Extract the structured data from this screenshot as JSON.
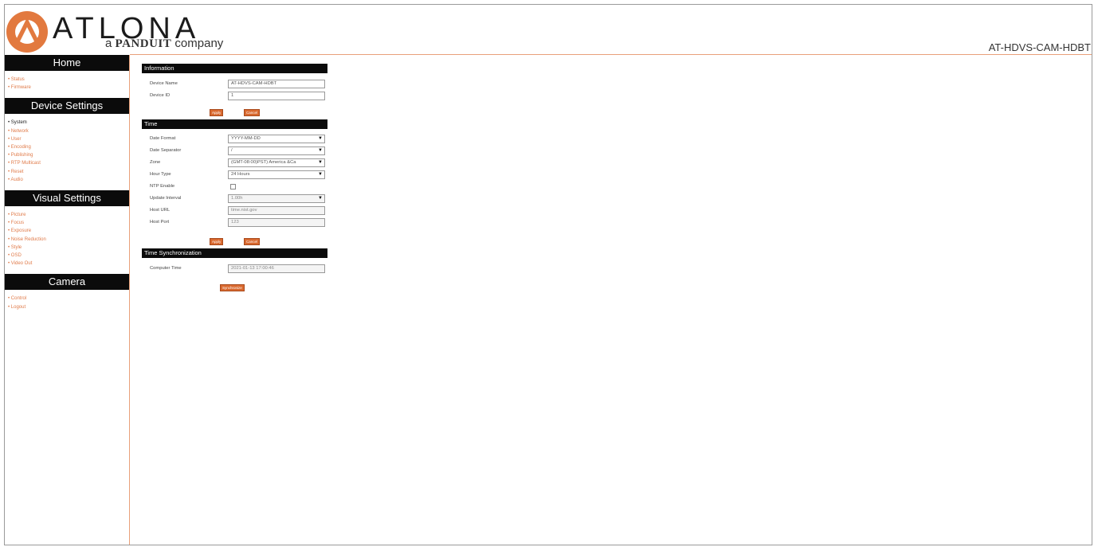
{
  "header": {
    "brand": "ATLONA",
    "tagline_prefix": "a",
    "tagline_brand": "PANDUIT",
    "tagline_suffix": "company",
    "model": "AT-HDVS-CAM-HDBT"
  },
  "sidebar": {
    "sections": [
      {
        "title": "Home",
        "items": [
          "Status",
          "Firmware"
        ]
      },
      {
        "title": "Device Settings",
        "items": [
          "System",
          "Network",
          "User",
          "Encoding",
          "Publishing",
          "RTP Multicast",
          "Reset",
          "Audio"
        ]
      },
      {
        "title": "Visual Settings",
        "items": [
          "Picture",
          "Focus",
          "Exposure",
          "Noise Reduction",
          "Style",
          "OSD",
          "Video Out"
        ]
      },
      {
        "title": "Camera",
        "items": [
          "Control",
          "Logout"
        ]
      }
    ]
  },
  "information": {
    "title": "Information",
    "device_name_label": "Device Name",
    "device_name_value": "AT-HDVS-CAM-HDBT",
    "device_id_label": "Device ID",
    "device_id_value": "1",
    "apply_label": "Apply",
    "cancel_label": "Cancel"
  },
  "time": {
    "title": "Time",
    "date_format_label": "Date Format",
    "date_format_value": "YYYY-MM-DD",
    "date_separator_label": "Date Separator",
    "date_separator_value": "/",
    "zone_label": "Zone",
    "zone_value": "(GMT-08:00)PST) America &Ca",
    "hour_type_label": "Hour Type",
    "hour_type_value": "24 Hours",
    "ntp_enable_label": "NTP Enable",
    "update_interval_label": "Update Interval",
    "update_interval_value": "1.00h",
    "host_url_label": "Host URL",
    "host_url_value": "time.nist.gov",
    "host_port_label": "Host Port",
    "host_port_value": "123",
    "apply_label": "Apply",
    "cancel_label": "Cancel"
  },
  "sync": {
    "title": "Time Synchronization",
    "computer_time_label": "Computer Time",
    "computer_time_value": "2021-01-13 17:00:46",
    "sync_label": "Synchronize"
  },
  "colors": {
    "accent": "#d9692f",
    "link": "#e07b4a",
    "section_bg": "#0b0b0b"
  }
}
